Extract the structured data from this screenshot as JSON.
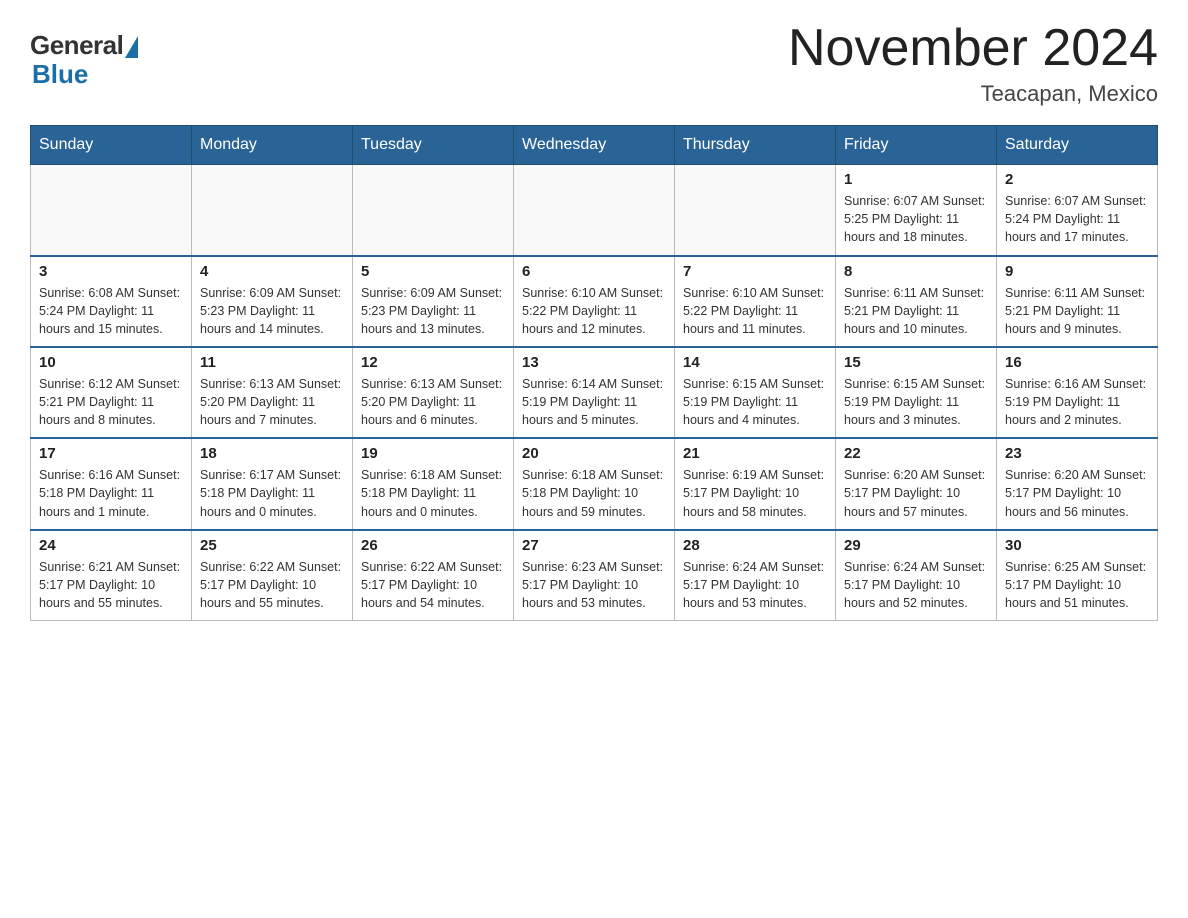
{
  "header": {
    "logo_general": "General",
    "logo_blue": "Blue",
    "month_title": "November 2024",
    "location": "Teacapan, Mexico"
  },
  "days_of_week": [
    "Sunday",
    "Monday",
    "Tuesday",
    "Wednesday",
    "Thursday",
    "Friday",
    "Saturday"
  ],
  "weeks": [
    [
      {
        "day": "",
        "info": ""
      },
      {
        "day": "",
        "info": ""
      },
      {
        "day": "",
        "info": ""
      },
      {
        "day": "",
        "info": ""
      },
      {
        "day": "",
        "info": ""
      },
      {
        "day": "1",
        "info": "Sunrise: 6:07 AM\nSunset: 5:25 PM\nDaylight: 11 hours and 18 minutes."
      },
      {
        "day": "2",
        "info": "Sunrise: 6:07 AM\nSunset: 5:24 PM\nDaylight: 11 hours and 17 minutes."
      }
    ],
    [
      {
        "day": "3",
        "info": "Sunrise: 6:08 AM\nSunset: 5:24 PM\nDaylight: 11 hours and 15 minutes."
      },
      {
        "day": "4",
        "info": "Sunrise: 6:09 AM\nSunset: 5:23 PM\nDaylight: 11 hours and 14 minutes."
      },
      {
        "day": "5",
        "info": "Sunrise: 6:09 AM\nSunset: 5:23 PM\nDaylight: 11 hours and 13 minutes."
      },
      {
        "day": "6",
        "info": "Sunrise: 6:10 AM\nSunset: 5:22 PM\nDaylight: 11 hours and 12 minutes."
      },
      {
        "day": "7",
        "info": "Sunrise: 6:10 AM\nSunset: 5:22 PM\nDaylight: 11 hours and 11 minutes."
      },
      {
        "day": "8",
        "info": "Sunrise: 6:11 AM\nSunset: 5:21 PM\nDaylight: 11 hours and 10 minutes."
      },
      {
        "day": "9",
        "info": "Sunrise: 6:11 AM\nSunset: 5:21 PM\nDaylight: 11 hours and 9 minutes."
      }
    ],
    [
      {
        "day": "10",
        "info": "Sunrise: 6:12 AM\nSunset: 5:21 PM\nDaylight: 11 hours and 8 minutes."
      },
      {
        "day": "11",
        "info": "Sunrise: 6:13 AM\nSunset: 5:20 PM\nDaylight: 11 hours and 7 minutes."
      },
      {
        "day": "12",
        "info": "Sunrise: 6:13 AM\nSunset: 5:20 PM\nDaylight: 11 hours and 6 minutes."
      },
      {
        "day": "13",
        "info": "Sunrise: 6:14 AM\nSunset: 5:19 PM\nDaylight: 11 hours and 5 minutes."
      },
      {
        "day": "14",
        "info": "Sunrise: 6:15 AM\nSunset: 5:19 PM\nDaylight: 11 hours and 4 minutes."
      },
      {
        "day": "15",
        "info": "Sunrise: 6:15 AM\nSunset: 5:19 PM\nDaylight: 11 hours and 3 minutes."
      },
      {
        "day": "16",
        "info": "Sunrise: 6:16 AM\nSunset: 5:19 PM\nDaylight: 11 hours and 2 minutes."
      }
    ],
    [
      {
        "day": "17",
        "info": "Sunrise: 6:16 AM\nSunset: 5:18 PM\nDaylight: 11 hours and 1 minute."
      },
      {
        "day": "18",
        "info": "Sunrise: 6:17 AM\nSunset: 5:18 PM\nDaylight: 11 hours and 0 minutes."
      },
      {
        "day": "19",
        "info": "Sunrise: 6:18 AM\nSunset: 5:18 PM\nDaylight: 11 hours and 0 minutes."
      },
      {
        "day": "20",
        "info": "Sunrise: 6:18 AM\nSunset: 5:18 PM\nDaylight: 10 hours and 59 minutes."
      },
      {
        "day": "21",
        "info": "Sunrise: 6:19 AM\nSunset: 5:17 PM\nDaylight: 10 hours and 58 minutes."
      },
      {
        "day": "22",
        "info": "Sunrise: 6:20 AM\nSunset: 5:17 PM\nDaylight: 10 hours and 57 minutes."
      },
      {
        "day": "23",
        "info": "Sunrise: 6:20 AM\nSunset: 5:17 PM\nDaylight: 10 hours and 56 minutes."
      }
    ],
    [
      {
        "day": "24",
        "info": "Sunrise: 6:21 AM\nSunset: 5:17 PM\nDaylight: 10 hours and 55 minutes."
      },
      {
        "day": "25",
        "info": "Sunrise: 6:22 AM\nSunset: 5:17 PM\nDaylight: 10 hours and 55 minutes."
      },
      {
        "day": "26",
        "info": "Sunrise: 6:22 AM\nSunset: 5:17 PM\nDaylight: 10 hours and 54 minutes."
      },
      {
        "day": "27",
        "info": "Sunrise: 6:23 AM\nSunset: 5:17 PM\nDaylight: 10 hours and 53 minutes."
      },
      {
        "day": "28",
        "info": "Sunrise: 6:24 AM\nSunset: 5:17 PM\nDaylight: 10 hours and 53 minutes."
      },
      {
        "day": "29",
        "info": "Sunrise: 6:24 AM\nSunset: 5:17 PM\nDaylight: 10 hours and 52 minutes."
      },
      {
        "day": "30",
        "info": "Sunrise: 6:25 AM\nSunset: 5:17 PM\nDaylight: 10 hours and 51 minutes."
      }
    ]
  ]
}
